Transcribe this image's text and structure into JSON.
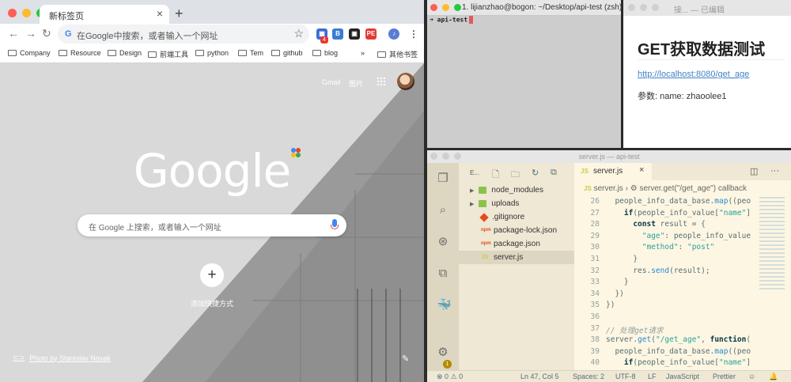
{
  "chrome": {
    "tab_title": "新标签页",
    "omnibox_placeholder": "在Google中搜索，或者输入一个网址",
    "extension_badge": "4",
    "bookmarks": [
      "Company",
      "Resource",
      "Design",
      "前端工具",
      "python",
      "Tem",
      "github",
      "blog"
    ],
    "bookmarks_more": "»",
    "other_bookmarks": "其他书签",
    "gmail": "Gmail",
    "images": "图片",
    "logo": "Google",
    "search_placeholder": "在 Google 上搜索，或者输入一个网址",
    "add_shortcut_label": "添加快捷方式",
    "photo_credit": "Photo by Stanislav Novak"
  },
  "terminal": {
    "title": "1. lijianzhao@bogon: ~/Desktop/api-test (zsh)",
    "prompt": "➜  api-test"
  },
  "preview": {
    "title": "接... — 已编辑",
    "heading": "GET获取数据测试",
    "link": "http://localhost:8080/get_age",
    "param": "参数: name: zhaoolee1"
  },
  "vscode": {
    "title": "server.js — api-test",
    "explorer_header": "E...",
    "files": [
      {
        "name": "node_modules",
        "type": "folder"
      },
      {
        "name": "uploads",
        "type": "folder"
      },
      {
        "name": ".gitignore",
        "type": "git"
      },
      {
        "name": "package-lock.json",
        "type": "json"
      },
      {
        "name": "package.json",
        "type": "json"
      },
      {
        "name": "server.js",
        "type": "js"
      }
    ],
    "tab_label": "server.js",
    "tab_icon": "JS",
    "breadcrumb_file": "server.js",
    "breadcrumb_symbol": "server.get(\"/get_age\") callback",
    "code_lines": [
      {
        "n": "26",
        "t": "  people_info_data_base.map((peo"
      },
      {
        "n": "27",
        "t": "    if(people_info_value[\"name\"]"
      },
      {
        "n": "28",
        "t": "      const result = {"
      },
      {
        "n": "29",
        "t": "        \"age\": people_info_value"
      },
      {
        "n": "30",
        "t": "        \"method\": \"post\""
      },
      {
        "n": "31",
        "t": "      }"
      },
      {
        "n": "32",
        "t": "      res.send(result);"
      },
      {
        "n": "33",
        "t": "    }"
      },
      {
        "n": "34",
        "t": "  })"
      },
      {
        "n": "35",
        "t": "})"
      },
      {
        "n": "36",
        "t": ""
      },
      {
        "n": "37",
        "t": "// 处理get请求"
      },
      {
        "n": "38",
        "t": "server.get(\"/get_age\", function("
      },
      {
        "n": "39",
        "t": "  people_info_data_base.map((peo"
      },
      {
        "n": "40",
        "t": "    if(people_info_value[\"name\"]"
      }
    ],
    "status": {
      "errors": "0",
      "warnings": "0",
      "position": "Ln 47, Col 5",
      "spaces": "Spaces: 2",
      "encoding": "UTF-8",
      "eol": "LF",
      "language": "JavaScript",
      "formatter": "Prettier"
    },
    "activity_badge": "1"
  },
  "colors": {
    "traffic_red": "#fc5f57",
    "traffic_yellow": "#fdbc2e",
    "traffic_green": "#28c840",
    "solarized_bg": "#fdf6e3",
    "link_blue": "#4183c4"
  }
}
